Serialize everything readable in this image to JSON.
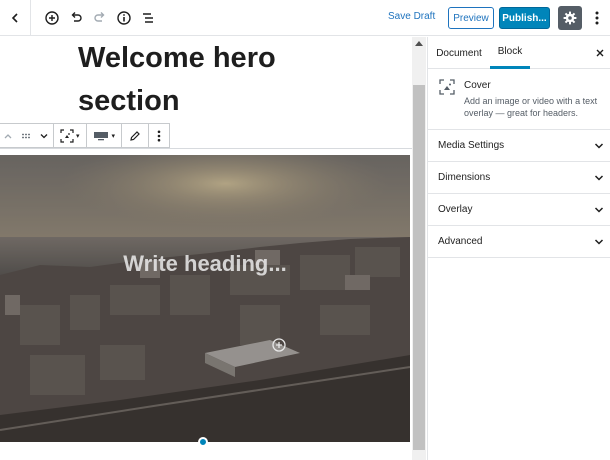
{
  "toolbar": {
    "back_icon": "chevron-left-icon",
    "add_icon": "plus-circle-icon",
    "undo_icon": "undo-icon",
    "redo_icon": "redo-icon",
    "info_icon": "info-icon",
    "outline_icon": "list-icon",
    "save_draft_label": "Save Draft",
    "preview_label": "Preview",
    "publish_label": "Publish...",
    "settings_icon": "gear-icon",
    "more_icon": "more-vertical-icon"
  },
  "editor": {
    "title": "Welcome hero section",
    "cover_heading": "Write heading...",
    "cover_heading_placeholder": "Write heading...",
    "block_toolbar": {
      "move_icon": "chevron-up-icon",
      "drag_icon": "drag-handle-icon",
      "collapse_icon": "chevron-down-icon",
      "transform_icon": "cover-block-icon",
      "align_icon": "full-width-icon",
      "edit_icon": "pencil-icon",
      "more_icon": "more-vertical-icon"
    }
  },
  "sidebar": {
    "tabs": [
      {
        "label": "Document",
        "active": false
      },
      {
        "label": "Block",
        "active": true
      }
    ],
    "block_card": {
      "title": "Cover",
      "description": "Add an image or video with a text overlay — great for headers."
    },
    "panels": [
      {
        "label": "Media Settings"
      },
      {
        "label": "Dimensions"
      },
      {
        "label": "Overlay"
      },
      {
        "label": "Advanced"
      }
    ]
  },
  "colors": {
    "accent": "#0085ba",
    "link": "#1e73be",
    "settings_bg": "#555d66"
  }
}
